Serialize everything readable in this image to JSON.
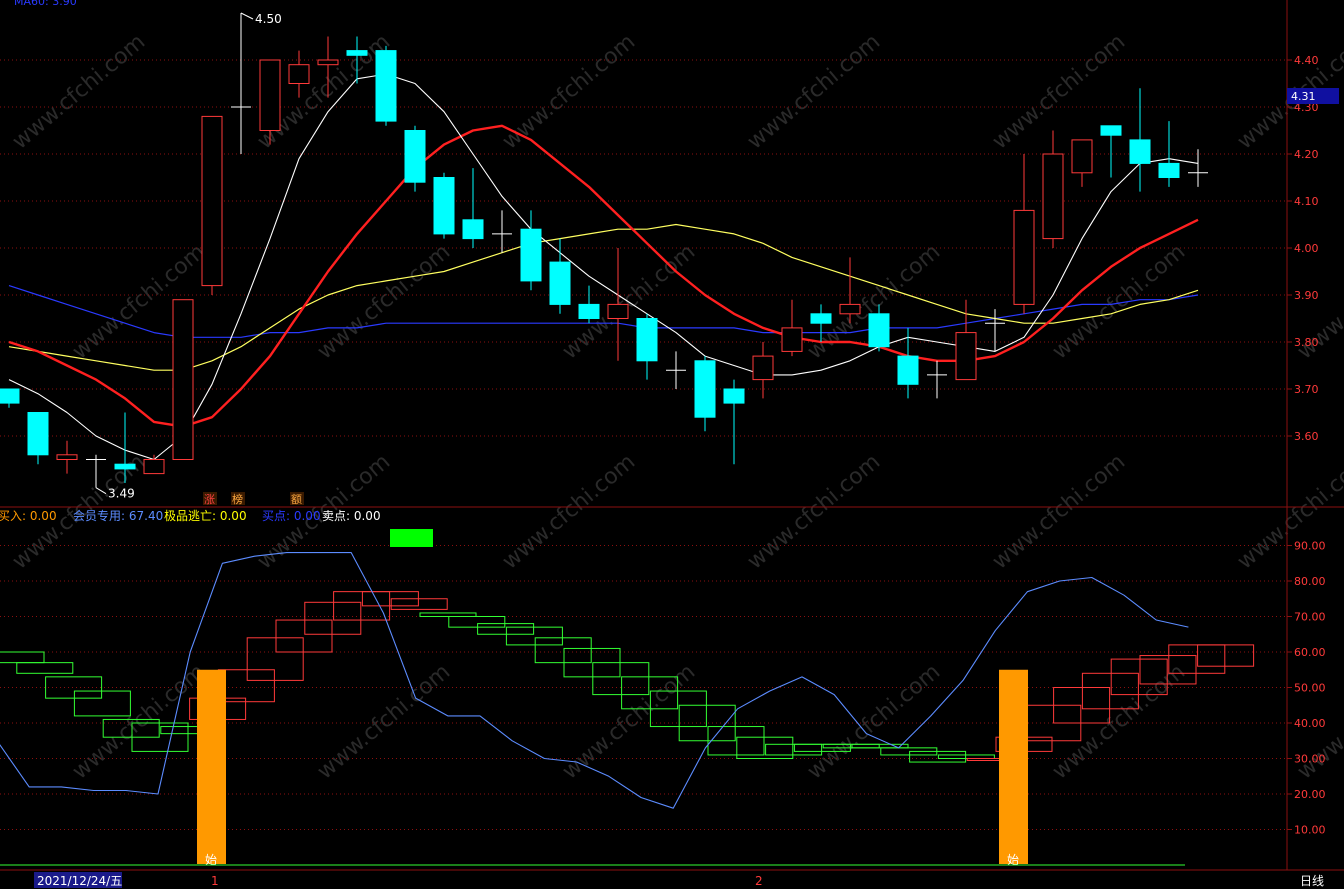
{
  "header": {
    "ma_label": "MA60: 3.90",
    "current_price": "4.31",
    "cycle": "日线"
  },
  "colors": {
    "up": "#ff3a3a",
    "down": "#00ffff",
    "ma5": "#ffffff",
    "ma10": "#ff2020",
    "ma20": "#ffff60",
    "ma60": "#2a3aff",
    "grid": "#8b1010",
    "macd_line": "#5c8cff",
    "hist_up": "#ff3a3a",
    "hist_down": "#33ff33",
    "signal_bar": "#ff9900"
  },
  "chart_data": [
    {
      "type": "candlestick",
      "y_ticks": [
        "4.40",
        "4.30",
        "4.20",
        "4.10",
        "4.00",
        "3.90",
        "3.80",
        "3.70",
        "3.60"
      ],
      "ylim": [
        3.48,
        4.5
      ],
      "annotations": {
        "high": "4.50",
        "low": "3.49"
      },
      "markers": [
        "涨",
        "榜",
        "额"
      ],
      "candles": [
        {
          "o": 3.7,
          "c": 3.67,
          "h": 3.7,
          "l": 3.66
        },
        {
          "o": 3.65,
          "c": 3.56,
          "h": 3.65,
          "l": 3.54
        },
        {
          "o": 3.55,
          "c": 3.56,
          "h": 3.59,
          "l": 3.52
        },
        {
          "o": 3.55,
          "c": 3.55,
          "h": 3.56,
          "l": 3.49
        },
        {
          "o": 3.54,
          "c": 3.53,
          "h": 3.65,
          "l": 3.5
        },
        {
          "o": 3.52,
          "c": 3.55,
          "h": 3.56,
          "l": 3.52
        },
        {
          "o": 3.55,
          "c": 3.89,
          "h": 3.89,
          "l": 3.55
        },
        {
          "o": 3.92,
          "c": 4.28,
          "h": 4.28,
          "l": 3.9
        },
        {
          "o": 4.3,
          "c": 4.3,
          "h": 4.5,
          "l": 4.2
        },
        {
          "o": 4.25,
          "c": 4.4,
          "h": 4.4,
          "l": 4.22
        },
        {
          "o": 4.35,
          "c": 4.39,
          "h": 4.42,
          "l": 4.32
        },
        {
          "o": 4.39,
          "c": 4.4,
          "h": 4.45,
          "l": 4.32
        },
        {
          "o": 4.42,
          "c": 4.41,
          "h": 4.45,
          "l": 4.35
        },
        {
          "o": 4.42,
          "c": 4.27,
          "h": 4.43,
          "l": 4.26
        },
        {
          "o": 4.25,
          "c": 4.14,
          "h": 4.26,
          "l": 4.12
        },
        {
          "o": 4.15,
          "c": 4.03,
          "h": 4.16,
          "l": 4.02
        },
        {
          "o": 4.06,
          "c": 4.02,
          "h": 4.17,
          "l": 4.0
        },
        {
          "o": 4.03,
          "c": 4.03,
          "h": 4.08,
          "l": 3.99
        },
        {
          "o": 4.04,
          "c": 3.93,
          "h": 4.08,
          "l": 3.91
        },
        {
          "o": 3.97,
          "c": 3.88,
          "h": 4.02,
          "l": 3.86
        },
        {
          "o": 3.88,
          "c": 3.85,
          "h": 3.92,
          "l": 3.84
        },
        {
          "o": 3.85,
          "c": 3.88,
          "h": 4.0,
          "l": 3.76
        },
        {
          "o": 3.85,
          "c": 3.76,
          "h": 3.86,
          "l": 3.72
        },
        {
          "o": 3.74,
          "c": 3.74,
          "h": 3.78,
          "l": 3.7
        },
        {
          "o": 3.76,
          "c": 3.64,
          "h": 3.77,
          "l": 3.61
        },
        {
          "o": 3.7,
          "c": 3.67,
          "h": 3.72,
          "l": 3.54
        },
        {
          "o": 3.72,
          "c": 3.77,
          "h": 3.8,
          "l": 3.68
        },
        {
          "o": 3.78,
          "c": 3.83,
          "h": 3.89,
          "l": 3.77
        },
        {
          "o": 3.86,
          "c": 3.84,
          "h": 3.88,
          "l": 3.8
        },
        {
          "o": 3.86,
          "c": 3.88,
          "h": 3.98,
          "l": 3.84
        },
        {
          "o": 3.86,
          "c": 3.79,
          "h": 3.88,
          "l": 3.78
        },
        {
          "o": 3.77,
          "c": 3.71,
          "h": 3.83,
          "l": 3.68
        },
        {
          "o": 3.73,
          "c": 3.73,
          "h": 3.76,
          "l": 3.68
        },
        {
          "o": 3.72,
          "c": 3.82,
          "h": 3.89,
          "l": 3.72
        },
        {
          "o": 3.84,
          "c": 3.84,
          "h": 3.87,
          "l": 3.78
        },
        {
          "o": 3.88,
          "c": 4.08,
          "h": 4.2,
          "l": 3.86
        },
        {
          "o": 4.02,
          "c": 4.2,
          "h": 4.25,
          "l": 4.0
        },
        {
          "o": 4.16,
          "c": 4.23,
          "h": 4.23,
          "l": 4.13
        },
        {
          "o": 4.26,
          "c": 4.24,
          "h": 4.26,
          "l": 4.15
        },
        {
          "o": 4.23,
          "c": 4.18,
          "h": 4.34,
          "l": 4.12
        },
        {
          "o": 4.18,
          "c": 4.15,
          "h": 4.27,
          "l": 4.13
        },
        {
          "o": 4.16,
          "c": 4.16,
          "h": 4.21,
          "l": 4.13
        }
      ],
      "ma5": [
        3.72,
        3.69,
        3.65,
        3.6,
        3.57,
        3.55,
        3.6,
        3.71,
        3.86,
        4.02,
        4.19,
        4.29,
        4.36,
        4.37,
        4.35,
        4.29,
        4.2,
        4.11,
        4.04,
        3.99,
        3.94,
        3.9,
        3.86,
        3.82,
        3.77,
        3.75,
        3.73,
        3.73,
        3.74,
        3.76,
        3.79,
        3.81,
        3.8,
        3.79,
        3.78,
        3.81,
        3.9,
        4.02,
        4.12,
        4.18,
        4.19,
        4.18
      ],
      "ma10": [
        3.8,
        3.78,
        3.75,
        3.72,
        3.68,
        3.63,
        3.62,
        3.64,
        3.7,
        3.77,
        3.86,
        3.95,
        4.03,
        4.1,
        4.17,
        4.22,
        4.25,
        4.26,
        4.23,
        4.18,
        4.13,
        4.07,
        4.01,
        3.95,
        3.9,
        3.86,
        3.83,
        3.81,
        3.8,
        3.8,
        3.79,
        3.77,
        3.76,
        3.76,
        3.77,
        3.8,
        3.85,
        3.91,
        3.96,
        4.0,
        4.03,
        4.06
      ],
      "ma20": [
        3.79,
        3.78,
        3.77,
        3.76,
        3.75,
        3.74,
        3.74,
        3.76,
        3.79,
        3.83,
        3.87,
        3.9,
        3.92,
        3.93,
        3.94,
        3.95,
        3.97,
        3.99,
        4.01,
        4.02,
        4.03,
        4.04,
        4.04,
        4.05,
        4.04,
        4.03,
        4.01,
        3.98,
        3.96,
        3.94,
        3.92,
        3.9,
        3.88,
        3.86,
        3.85,
        3.84,
        3.84,
        3.85,
        3.86,
        3.88,
        3.89,
        3.91
      ],
      "ma60": [
        3.92,
        3.9,
        3.88,
        3.86,
        3.84,
        3.82,
        3.81,
        3.81,
        3.81,
        3.82,
        3.82,
        3.83,
        3.83,
        3.84,
        3.84,
        3.84,
        3.84,
        3.84,
        3.84,
        3.84,
        3.84,
        3.84,
        3.83,
        3.83,
        3.83,
        3.83,
        3.82,
        3.82,
        3.82,
        3.82,
        3.83,
        3.83,
        3.83,
        3.84,
        3.85,
        3.86,
        3.87,
        3.88,
        3.88,
        3.89,
        3.89,
        3.9
      ]
    },
    {
      "type": "indicator",
      "legend": [
        {
          "label": "买入: 0.00",
          "color": "#ff9900"
        },
        {
          "label": "会员专用: 67.40",
          "color": "#5c8cff"
        },
        {
          "label": "极品逃亡: 0.00",
          "color": "#ffff00"
        },
        {
          "label": "买点: 0.00",
          "color": "#2a3aff"
        },
        {
          "label": "卖点: 0.00",
          "color": "#ffffff"
        }
      ],
      "y_ticks": [
        "90.00",
        "80.00",
        "70.00",
        "60.00",
        "50.00",
        "40.00",
        "30.00",
        "20.00",
        "10.00"
      ],
      "ylim": [
        0,
        100
      ],
      "line": [
        35,
        22,
        22,
        21,
        21,
        20,
        60,
        85,
        87,
        88,
        88,
        88,
        71,
        47,
        42,
        42,
        35,
        30,
        29,
        25,
        19,
        16,
        33,
        44,
        49,
        53,
        48,
        37,
        33,
        42,
        52,
        66,
        77,
        80,
        81,
        76,
        69,
        67
      ],
      "boxes": [
        {
          "o": 57,
          "c": 60,
          "up": false
        },
        {
          "o": 54,
          "c": 57,
          "up": false
        },
        {
          "o": 47,
          "c": 53,
          "up": false
        },
        {
          "o": 42,
          "c": 49,
          "up": false
        },
        {
          "o": 36,
          "c": 41,
          "up": false
        },
        {
          "o": 32,
          "c": 40,
          "up": false
        },
        {
          "o": 37,
          "c": 39,
          "up": false
        },
        {
          "o": 41,
          "c": 47,
          "up": true
        },
        {
          "o": 46,
          "c": 55,
          "up": true
        },
        {
          "o": 52,
          "c": 64,
          "up": true
        },
        {
          "o": 60,
          "c": 69,
          "up": true
        },
        {
          "o": 65,
          "c": 74,
          "up": true
        },
        {
          "o": 69,
          "c": 77,
          "up": true
        },
        {
          "o": 73,
          "c": 77,
          "up": true
        },
        {
          "o": 72,
          "c": 75,
          "up": true
        },
        {
          "o": 70,
          "c": 71,
          "up": false
        },
        {
          "o": 67,
          "c": 70,
          "up": false
        },
        {
          "o": 65,
          "c": 68,
          "up": false
        },
        {
          "o": 62,
          "c": 67,
          "up": false
        },
        {
          "o": 57,
          "c": 64,
          "up": false
        },
        {
          "o": 53,
          "c": 61,
          "up": false
        },
        {
          "o": 48,
          "c": 57,
          "up": false
        },
        {
          "o": 44,
          "c": 53,
          "up": false
        },
        {
          "o": 39,
          "c": 49,
          "up": false
        },
        {
          "o": 35,
          "c": 45,
          "up": false
        },
        {
          "o": 31,
          "c": 39,
          "up": false
        },
        {
          "o": 30,
          "c": 36,
          "up": false
        },
        {
          "o": 31,
          "c": 34,
          "up": false
        },
        {
          "o": 32,
          "c": 34,
          "up": false
        },
        {
          "o": 33,
          "c": 34,
          "up": false
        },
        {
          "o": 33,
          "c": 34,
          "up": false
        },
        {
          "o": 31,
          "c": 33,
          "up": false
        },
        {
          "o": 29,
          "c": 32,
          "up": false
        },
        {
          "o": 30,
          "c": 31,
          "up": false
        },
        {
          "o": 30,
          "c": 30,
          "up": true
        },
        {
          "o": 32,
          "c": 36,
          "up": true
        },
        {
          "o": 35,
          "c": 45,
          "up": true
        },
        {
          "o": 40,
          "c": 50,
          "up": true
        },
        {
          "o": 44,
          "c": 54,
          "up": true
        },
        {
          "o": 48,
          "c": 58,
          "up": true
        },
        {
          "o": 51,
          "c": 59,
          "up": true
        },
        {
          "o": 54,
          "c": 62,
          "up": true
        },
        {
          "o": 56,
          "c": 62,
          "up": true
        }
      ],
      "signal_bars": [
        {
          "index": 7,
          "value": 55,
          "label": "始"
        },
        {
          "index": 35,
          "value": 55,
          "label": "始"
        }
      ],
      "top_marker": {
        "index": 14,
        "color": "#00ff00"
      }
    }
  ],
  "bottom_axis": {
    "date": "2021/12/24/五",
    "marks": [
      "1",
      "2"
    ]
  },
  "watermark": "www.cfchi.com"
}
